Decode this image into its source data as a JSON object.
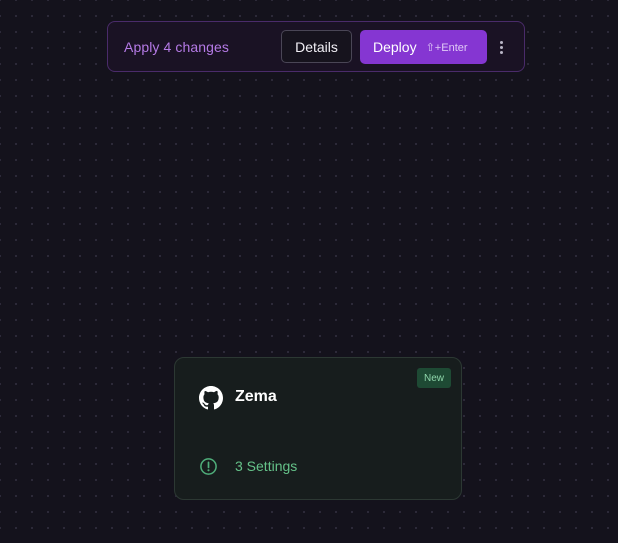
{
  "change_bar": {
    "message": "Apply 4 changes",
    "details_label": "Details",
    "deploy_label": "Deploy",
    "deploy_shortcut": "⇧+Enter",
    "more_icon": "vertical-ellipsis-icon"
  },
  "service_card": {
    "badge": "New",
    "icon": "github-icon",
    "name": "Zema",
    "status_icon": "alert-circle-icon",
    "status_text": "3 Settings"
  },
  "colors": {
    "background": "#14121c",
    "accent": "#8536d2",
    "change_text": "#b57ae6",
    "success": "#65c289"
  }
}
